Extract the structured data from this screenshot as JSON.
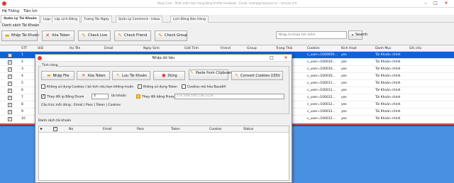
{
  "window": {
    "title": "Ninja Care - Phần mềm bán hàng bằng Profile Facebook - Email: lienhe@ninjacare.vn - Version 4.0",
    "min": "–",
    "max": "□",
    "close": "✕"
  },
  "menu": [
    "Hệ Thống",
    "Tiện Ích"
  ],
  "tabs": [
    "Quản Lý Tài Khoản",
    "Logs",
    "Lập Lịch Đăng",
    "Tương Tác Ngày",
    "Quản Lý Comment - Inbox",
    "Lịch Đăng Bán Hàng"
  ],
  "subtitle": "Danh sách Tài Khoản",
  "toolbar": {
    "buttons": [
      {
        "label": "Nhập Tài Khoản",
        "icon": "folder-icon"
      },
      {
        "label": "Xóa Token",
        "icon": "delete-icon"
      },
      {
        "label": "Check Live",
        "icon": "pencil-icon"
      },
      {
        "label": "Check Friend",
        "icon": "pencil-icon"
      },
      {
        "label": "Check Group",
        "icon": "pencil-icon"
      }
    ],
    "search_placeholder": "Nhập từ khóa tìm kiếm",
    "search_button": "Search"
  },
  "grid": {
    "headers": [
      "STT",
      "UID",
      "Họ Tên",
      "Email",
      "Ngày Sinh",
      "Giới Tính",
      "Friend",
      "Group",
      "Trạng Thái",
      "Cookies",
      "Kích Hoạt",
      "Danh Mục",
      "Ghi chú"
    ],
    "rows": [
      {
        "stt": "1",
        "cookies": "c_user=1000050...",
        "active": "yes",
        "category": "Tài Khoản chính",
        "selected": true
      },
      {
        "stt": "2",
        "cookies": "c_user=100010...",
        "active": "yes",
        "category": "Tài Khoản chính",
        "selected": false
      },
      {
        "stt": "3",
        "cookies": "c_user=100010...",
        "active": "yes",
        "category": "Tài Khoản chính",
        "selected": false
      },
      {
        "stt": "4",
        "cookies": "c_user=100010...",
        "active": "yes",
        "category": "Tài Khoản chính",
        "selected": false
      },
      {
        "stt": "5",
        "cookies": "c_user=100011...",
        "active": "yes",
        "category": "Tài Khoản chính",
        "selected": false
      },
      {
        "stt": "6",
        "cookies": "c_user=100011...",
        "active": "yes",
        "category": "Tài Khoản chính",
        "selected": false
      },
      {
        "stt": "7",
        "cookies": "c_user=100012...",
        "active": "yes",
        "category": "Tài Khoản chính",
        "selected": false
      },
      {
        "stt": "8",
        "cookies": "c_user=100012...",
        "active": "yes",
        "category": "Tài Khoản chính",
        "selected": false
      },
      {
        "stt": "9",
        "cookies": "c_user=100012...",
        "active": "yes",
        "category": "Tài Khoản chính",
        "selected": false
      },
      {
        "stt": "10",
        "cookies": "c_user=100012...",
        "active": "yes",
        "category": "Tài Khoản chính",
        "selected": false
      }
    ]
  },
  "dialog": {
    "title": "Nhập dữ liệu",
    "group_features": "Tính năng",
    "buttons": [
      {
        "label": "Nhập File",
        "icon": "folder-icon"
      },
      {
        "label": "Xóa Token",
        "icon": "delete-icon"
      },
      {
        "label": "Lưu Tài Khoản",
        "icon": "pencil-icon"
      },
      {
        "label": "Dừng",
        "icon": "stop-icon"
      },
      {
        "label": "Paste from Clipboard",
        "icon": "pencil-icon"
      },
      {
        "label": "Convert Cookies U3SV",
        "icon": "pencil-icon"
      }
    ],
    "options": {
      "no_cookies": "Không sử dụng Cookies ( bỏ tích nếu bạn không muốn",
      "no_token": "Không sử dụng Token",
      "cookies_base64": "Cookies mã hóa Base64",
      "change_ip": "Thay đổi ip Bằng Dcom",
      "ip_count": "3",
      "ip_unit": "tài khoản",
      "change_proxy": "Thay đổi bằng Proxy",
      "proxy_placeholder": "172.200.100.128:3128",
      "structure": "Cấu trúc mỗi dòng : Email | Pass | Token | Cookies"
    },
    "list_label": "Danh sách tài khoản",
    "list_headers": [
      "No",
      "Email",
      "Pass",
      "Token",
      "Cookies",
      "Status"
    ]
  },
  "colors": {
    "selected_row": "#0a64d6",
    "accent_blue": "#4a90e2",
    "red_icon": "#e53935"
  }
}
